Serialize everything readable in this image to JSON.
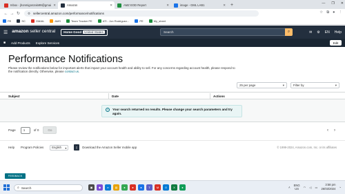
{
  "browser": {
    "tabs": [
      {
        "label": "Inbox - jhonmigonzalo99@gmai",
        "fav_color": "#d93025",
        "active": false
      },
      {
        "label": "Amazon",
        "fav_color": "#232f3e",
        "active": true
      },
      {
        "label": "AMZ EOD Report",
        "fav_color": "#1e8e3e",
        "active": false
      },
      {
        "label": "image - GML LAB1",
        "fav_color": "#1a73e8",
        "active": false
      }
    ],
    "new_tab": "+",
    "url": "sellercentral.amazon.com/performance/notifications",
    "bookmarks": [
      {
        "label": "PE",
        "color": "#1a73e8"
      },
      {
        "label": "SC",
        "color": "#232f3e"
      },
      {
        "label": "GMAIL",
        "color": "#d93025"
      },
      {
        "label": "AMS",
        "color": "#ff9900"
      },
      {
        "label": "Team Tracker PE",
        "color": "#1e8e3e"
      },
      {
        "label": "ATI - Jon Rodriguez...",
        "color": "#1e8e3e"
      },
      {
        "label": "PE",
        "color": "#1a73e8"
      },
      {
        "label": "My_sheet",
        "color": "#1e8e3e"
      }
    ]
  },
  "amazon": {
    "logo_bold": "amazon",
    "logo_light": " seller central",
    "store_name": "Home Good",
    "store_country": "United States",
    "search_placeholder": "Search",
    "lang": "EN",
    "help": "Help",
    "sec_nav": [
      "Add Products",
      "Explore Services"
    ],
    "edit": "Edit"
  },
  "page": {
    "title": "Performance Notifications",
    "description": "Please review the notifications below for important alerts that impact your account health and ability to sell. For any concerns regarding account health, please respond to the notification directly. Otherwise, please ",
    "contact_link": "contact us",
    "description_end": ".",
    "per_page": "25 per page",
    "filter": "Filter by",
    "columns": [
      "Subject",
      "Date",
      "Actions"
    ],
    "alert": "Your search returned no results. Please change your search parameters and try again.",
    "page_label": "Page",
    "page_value": "1",
    "of_label": "of 0",
    "go": "Go"
  },
  "footer": {
    "help": "Help",
    "policies": "Program Policies",
    "language": "English",
    "app_text": "Download the Amazon Seller mobile app",
    "copyright": "© 1999-2024, Amazon.com, Inc. or its affiliates",
    "feedback": "FEEDBACK"
  },
  "taskbar": {
    "search": "Search",
    "lang_top": "ENG",
    "lang_bottom": "US",
    "time": "3:58 pm",
    "date": "26/03/2024"
  }
}
